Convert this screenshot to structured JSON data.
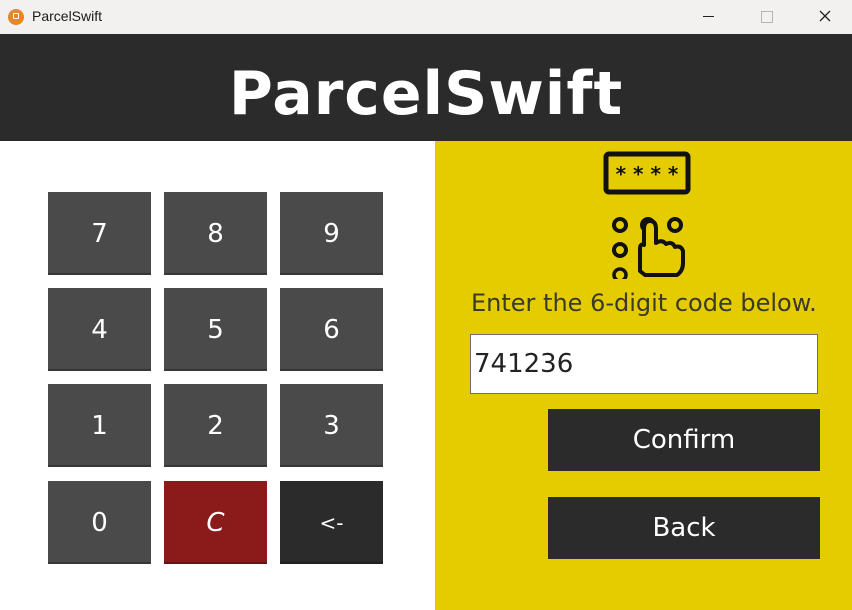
{
  "window": {
    "title": "ParcelSwift"
  },
  "header": {
    "brand": "ParcelSwift"
  },
  "keypad": {
    "keys": [
      "7",
      "8",
      "9",
      "4",
      "5",
      "6",
      "1",
      "2",
      "3",
      "0",
      "C",
      "<-"
    ]
  },
  "entry": {
    "prompt": "Enter the 6-digit code below.",
    "code_value": "741236",
    "confirm_label": "Confirm",
    "back_label": "Back"
  },
  "colors": {
    "header_bg": "#2b2b2b",
    "panel_accent": "#e5cc00",
    "key_bg": "#4a4a4a",
    "clear_key_bg": "#8b1a1a",
    "button_bg": "#2b2b2b"
  },
  "icons": {
    "app": "app-icon",
    "pin_pad": "keypad-touch-icon"
  }
}
